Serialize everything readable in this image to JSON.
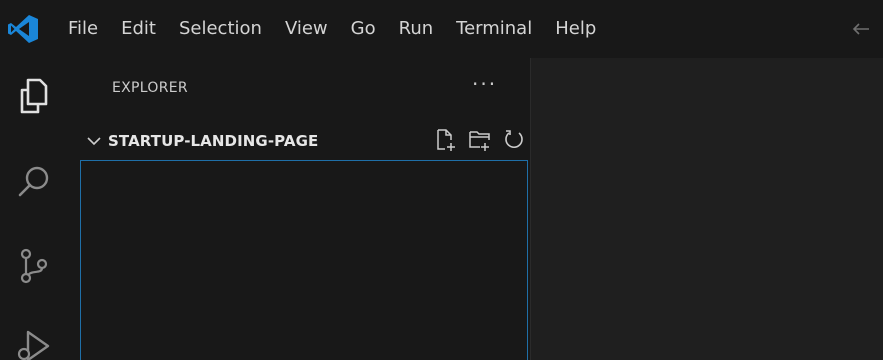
{
  "menu": {
    "items": [
      "File",
      "Edit",
      "Selection",
      "View",
      "Go",
      "Run",
      "Terminal",
      "Help"
    ]
  },
  "activity_bar": {
    "icons": [
      "explorer-icon",
      "search-icon",
      "source-control-icon",
      "run-debug-icon"
    ]
  },
  "sidebar": {
    "header": "EXPLORER",
    "more_label": "···",
    "folder_name": "STARTUP-LANDING-PAGE",
    "actions": [
      "new-file-icon",
      "new-folder-icon",
      "refresh-icon",
      "collapse-all-icon"
    ]
  },
  "colors": {
    "accent": "#0078d4",
    "logo": "#23a9f2",
    "focus_border": "#1f6fa8",
    "background": "#1f1f1f",
    "sidebar": "#181818"
  }
}
